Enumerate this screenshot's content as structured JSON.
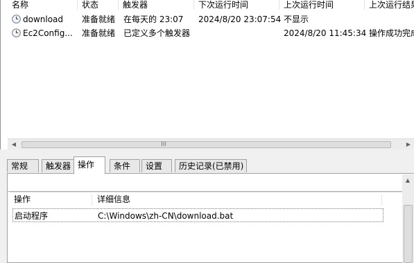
{
  "task_list": {
    "columns": [
      "名称",
      "状态",
      "触发器",
      "下次运行时间",
      "上次运行时间",
      "上次运行结果"
    ],
    "rows": [
      {
        "name": "download",
        "status": "准备就绪",
        "trigger": "在每天的 23:07",
        "next_run": "2024/8/20 23:07:54",
        "last_run": "不显示",
        "last_result": ""
      },
      {
        "name": "Ec2Config...",
        "status": "准备就绪",
        "trigger": "已定义多个触发器",
        "next_run": "",
        "last_run": "2024/8/20 11:45:34",
        "last_result": "操作成功完成"
      }
    ],
    "scroll_grip": "III",
    "icon": "clock-icon"
  },
  "tabs": [
    {
      "label": "常规",
      "active": false
    },
    {
      "label": "触发器",
      "active": false
    },
    {
      "label": "操作",
      "active": true
    },
    {
      "label": "条件",
      "active": false
    },
    {
      "label": "设置",
      "active": false
    },
    {
      "label": "历史记录(已禁用)",
      "active": false
    }
  ],
  "actions_panel": {
    "columns": [
      "操作",
      "详细信息"
    ],
    "rows": [
      {
        "action": "启动程序",
        "details": "C:\\Windows\\zh-CN\\download.bat"
      }
    ]
  }
}
